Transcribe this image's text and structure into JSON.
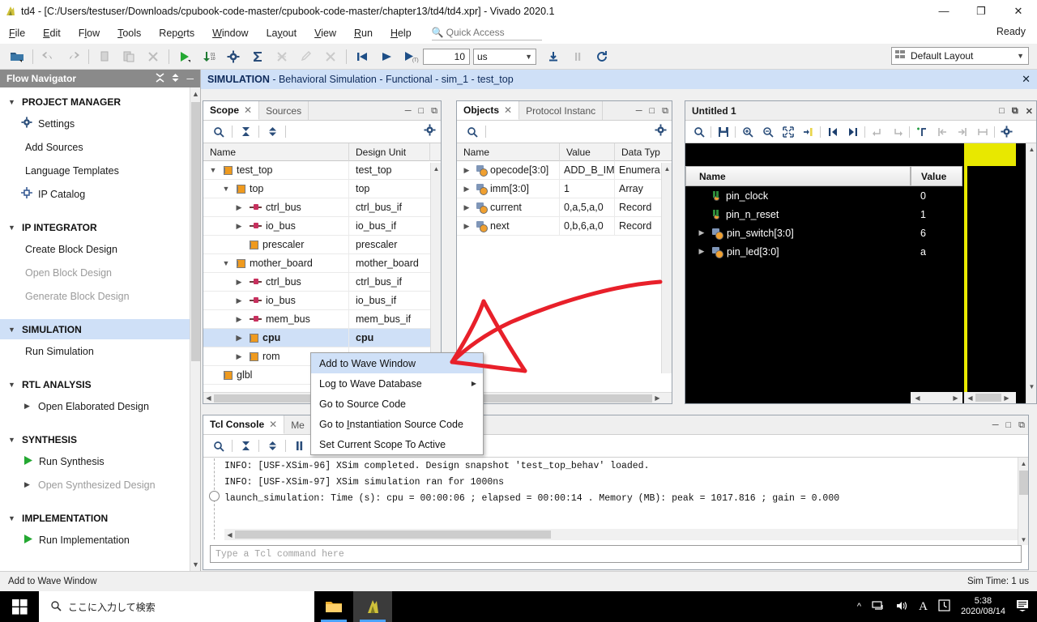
{
  "window": {
    "title": "td4 - [C:/Users/testuser/Downloads/cpubook-code-master/cpubook-code-master/chapter13/td4/td4.xpr] - Vivado 2020.1",
    "minimize": "—",
    "restore": "❐",
    "close": "✕"
  },
  "menubar": {
    "items": [
      "File",
      "Edit",
      "Flow",
      "Tools",
      "Reports",
      "Window",
      "Layout",
      "View",
      "Run",
      "Help"
    ],
    "quick_access_placeholder": "Quick Access",
    "ready_label": "Ready"
  },
  "toolbar": {
    "time_value": "10",
    "time_unit": "us",
    "layout_label": "Default Layout"
  },
  "flow_navigator": {
    "title": "Flow Navigator",
    "sections": [
      {
        "label": "PROJECT MANAGER",
        "active": false,
        "items": [
          {
            "label": "Settings",
            "icon": "gear-icon",
            "dim": false,
            "chev": false
          },
          {
            "label": "Add Sources",
            "icon": "",
            "dim": false,
            "chev": false
          },
          {
            "label": "Language Templates",
            "icon": "",
            "dim": false,
            "chev": false
          },
          {
            "label": "IP Catalog",
            "icon": "ip-icon",
            "dim": false,
            "chev": false
          }
        ]
      },
      {
        "label": "IP INTEGRATOR",
        "active": false,
        "items": [
          {
            "label": "Create Block Design",
            "icon": "",
            "dim": false,
            "chev": false
          },
          {
            "label": "Open Block Design",
            "icon": "",
            "dim": true,
            "chev": false
          },
          {
            "label": "Generate Block Design",
            "icon": "",
            "dim": true,
            "chev": false
          }
        ]
      },
      {
        "label": "SIMULATION",
        "active": true,
        "items": [
          {
            "label": "Run Simulation",
            "icon": "",
            "dim": false,
            "chev": false
          }
        ]
      },
      {
        "label": "RTL ANALYSIS",
        "active": false,
        "items": [
          {
            "label": "Open Elaborated Design",
            "icon": "",
            "dim": false,
            "chev": true
          }
        ]
      },
      {
        "label": "SYNTHESIS",
        "active": false,
        "items": [
          {
            "label": "Run Synthesis",
            "icon": "play-icon",
            "dim": false,
            "chev": false
          },
          {
            "label": "Open Synthesized Design",
            "icon": "",
            "dim": true,
            "chev": true
          }
        ]
      },
      {
        "label": "IMPLEMENTATION",
        "active": false,
        "items": [
          {
            "label": "Run Implementation",
            "icon": "play-icon",
            "dim": false,
            "chev": false
          }
        ]
      }
    ]
  },
  "sim_banner": {
    "bold": "SIMULATION",
    "rest": " - Behavioral Simulation - Functional - sim_1 - test_top",
    "close": "✕"
  },
  "scope_panel": {
    "tabs": [
      {
        "label": "Scope",
        "active": true,
        "closable": true
      },
      {
        "label": "Sources",
        "active": false,
        "closable": false
      }
    ],
    "columns": [
      "Name",
      "Design Unit"
    ],
    "rows": [
      {
        "name": "test_top",
        "unit": "test_top",
        "indent": 0,
        "expander": "v",
        "icon": "module-icon",
        "selected": false
      },
      {
        "name": "top",
        "unit": "top",
        "indent": 1,
        "expander": "v",
        "icon": "module-icon",
        "selected": false
      },
      {
        "name": "ctrl_bus",
        "unit": "ctrl_bus_if",
        "indent": 2,
        "expander": ">",
        "icon": "bus-icon",
        "selected": false
      },
      {
        "name": "io_bus",
        "unit": "io_bus_if",
        "indent": 2,
        "expander": ">",
        "icon": "bus-icon",
        "selected": false
      },
      {
        "name": "prescaler",
        "unit": "prescaler",
        "indent": 2,
        "expander": "",
        "icon": "module-icon",
        "selected": false
      },
      {
        "name": "mother_board",
        "unit": "mother_board",
        "indent": 1,
        "expander": "v",
        "icon": "module-icon",
        "selected": false
      },
      {
        "name": "ctrl_bus",
        "unit": "ctrl_bus_if",
        "indent": 2,
        "expander": ">",
        "icon": "bus-icon",
        "selected": false
      },
      {
        "name": "io_bus",
        "unit": "io_bus_if",
        "indent": 2,
        "expander": ">",
        "icon": "bus-icon",
        "selected": false
      },
      {
        "name": "mem_bus",
        "unit": "mem_bus_if",
        "indent": 2,
        "expander": ">",
        "icon": "bus-icon",
        "selected": false
      },
      {
        "name": "cpu",
        "unit": "cpu",
        "indent": 2,
        "expander": ">",
        "icon": "module-icon",
        "selected": true
      },
      {
        "name": "rom",
        "unit": "",
        "indent": 2,
        "expander": ">",
        "icon": "module-icon",
        "selected": false
      },
      {
        "name": "glbl",
        "unit": "",
        "indent": 0,
        "expander": "",
        "icon": "module-icon",
        "selected": false
      }
    ]
  },
  "context_menu": {
    "items": [
      {
        "label": "Add to Wave Window",
        "highlighted": true,
        "submenu": false
      },
      {
        "label": "Log to Wave Database",
        "highlighted": false,
        "submenu": true
      },
      {
        "label": "Go to Source Code",
        "highlighted": false,
        "submenu": false
      },
      {
        "label": "Go to Instantiation Source Code",
        "highlighted": false,
        "submenu": false
      },
      {
        "label": "Set Current Scope To Active",
        "highlighted": false,
        "submenu": false
      }
    ]
  },
  "objects_panel": {
    "tabs": [
      {
        "label": "Objects",
        "active": true,
        "closable": true
      },
      {
        "label": "Protocol Instanc",
        "active": false,
        "closable": false
      }
    ],
    "columns": [
      "Name",
      "Value",
      "Data Typ"
    ],
    "rows": [
      {
        "name": "opecode[3:0]",
        "value": "ADD_B_IMM",
        "type": "Enumera"
      },
      {
        "name": "imm[3:0]",
        "value": "1",
        "type": "Array"
      },
      {
        "name": "current",
        "value": "0,a,5,a,0",
        "type": "Record"
      },
      {
        "name": "next",
        "value": "0,b,6,a,0",
        "type": "Record"
      }
    ]
  },
  "wave_panel": {
    "title": "Untitled 1",
    "columns": [
      "Name",
      "Value"
    ],
    "rows": [
      {
        "name": "pin_clock",
        "value": "0",
        "expander": "",
        "icon": "wire-icon"
      },
      {
        "name": "pin_n_reset",
        "value": "1",
        "expander": "",
        "icon": "wire-icon"
      },
      {
        "name": "pin_switch[3:0]",
        "value": "6",
        "expander": ">",
        "icon": "bus-obj-icon"
      },
      {
        "name": "pin_led[3:0]",
        "value": "a",
        "expander": ">",
        "icon": "bus-obj-icon"
      }
    ]
  },
  "tcl_panel": {
    "tabs": [
      {
        "label": "Tcl Console",
        "active": true,
        "closable": true
      },
      {
        "label": "Me",
        "active": false,
        "closable": false
      }
    ],
    "lines": [
      "INFO: [USF-XSim-96] XSim completed. Design snapshot 'test_top_behav' loaded.",
      "INFO: [USF-XSim-97] XSim simulation ran for 1000ns",
      "launch_simulation: Time (s): cpu = 00:00:06 ; elapsed = 00:00:14 . Memory (MB): peak = 1017.816 ; gain = 0.000"
    ],
    "input_placeholder": "Type a Tcl command here"
  },
  "statusbar": {
    "left": "Add to Wave Window",
    "right": "Sim Time: 1 us"
  },
  "taskbar": {
    "search_placeholder": "ここに入力して検索",
    "time": "5:38",
    "date": "2020/08/14"
  },
  "colors": {
    "accent": "#cfe0f7",
    "annotation": "#e8202a",
    "module": "#ef9a1e",
    "taskbar": "#000000"
  }
}
